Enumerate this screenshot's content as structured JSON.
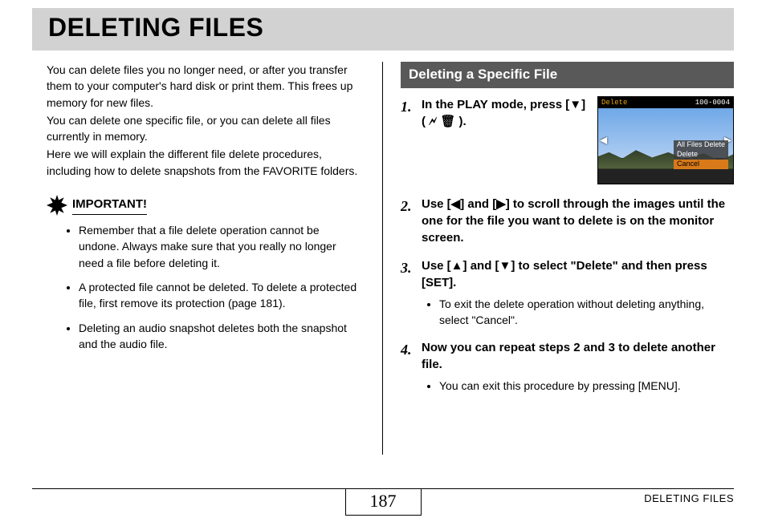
{
  "title": "DELETING FILES",
  "intro": {
    "p1": "You can delete files you no longer need, or after you transfer them to your computer's hard disk or print them. This frees up memory for new files.",
    "p2": "You can delete one specific file, or you can delete all files currently in memory.",
    "p3": "Here we will explain the different file delete procedures, including how to delete snapshots from the FAVORITE folders."
  },
  "important": {
    "label": "IMPORTANT!",
    "items": [
      "Remember that a file delete operation cannot be undone. Always make sure that you really no longer need a file before deleting it.",
      "A protected file cannot be deleted. To delete a protected file, first remove its protection (page 181).",
      "Deleting an audio snapshot deletes both the snapshot and the audio file."
    ]
  },
  "section": {
    "heading": "Deleting a Specific File",
    "steps": [
      {
        "num": "1.",
        "text_pre": "In the PLAY mode, press [",
        "text_post": "] ( 🗲 🗑 )."
      },
      {
        "num": "2.",
        "text": "Use [◀] and [▶] to scroll through the images until the one for the file you want to delete is on the monitor screen."
      },
      {
        "num": "3.",
        "text": "Use [▲] and [▼] to select \"Delete\" and then press [SET].",
        "sub": "To exit the delete operation without deleting anything, select \"Cancel\"."
      },
      {
        "num": "4.",
        "text": "Now you can repeat steps 2 and 3 to delete another file.",
        "sub": "You can exit this procedure by pressing [MENU]."
      }
    ]
  },
  "screenshot": {
    "top_left": "Delete",
    "top_right": "100-0004",
    "menu": [
      "All Files Delete",
      "Delete",
      "Cancel"
    ]
  },
  "footer": {
    "page": "187",
    "label": "DELETING FILES"
  }
}
